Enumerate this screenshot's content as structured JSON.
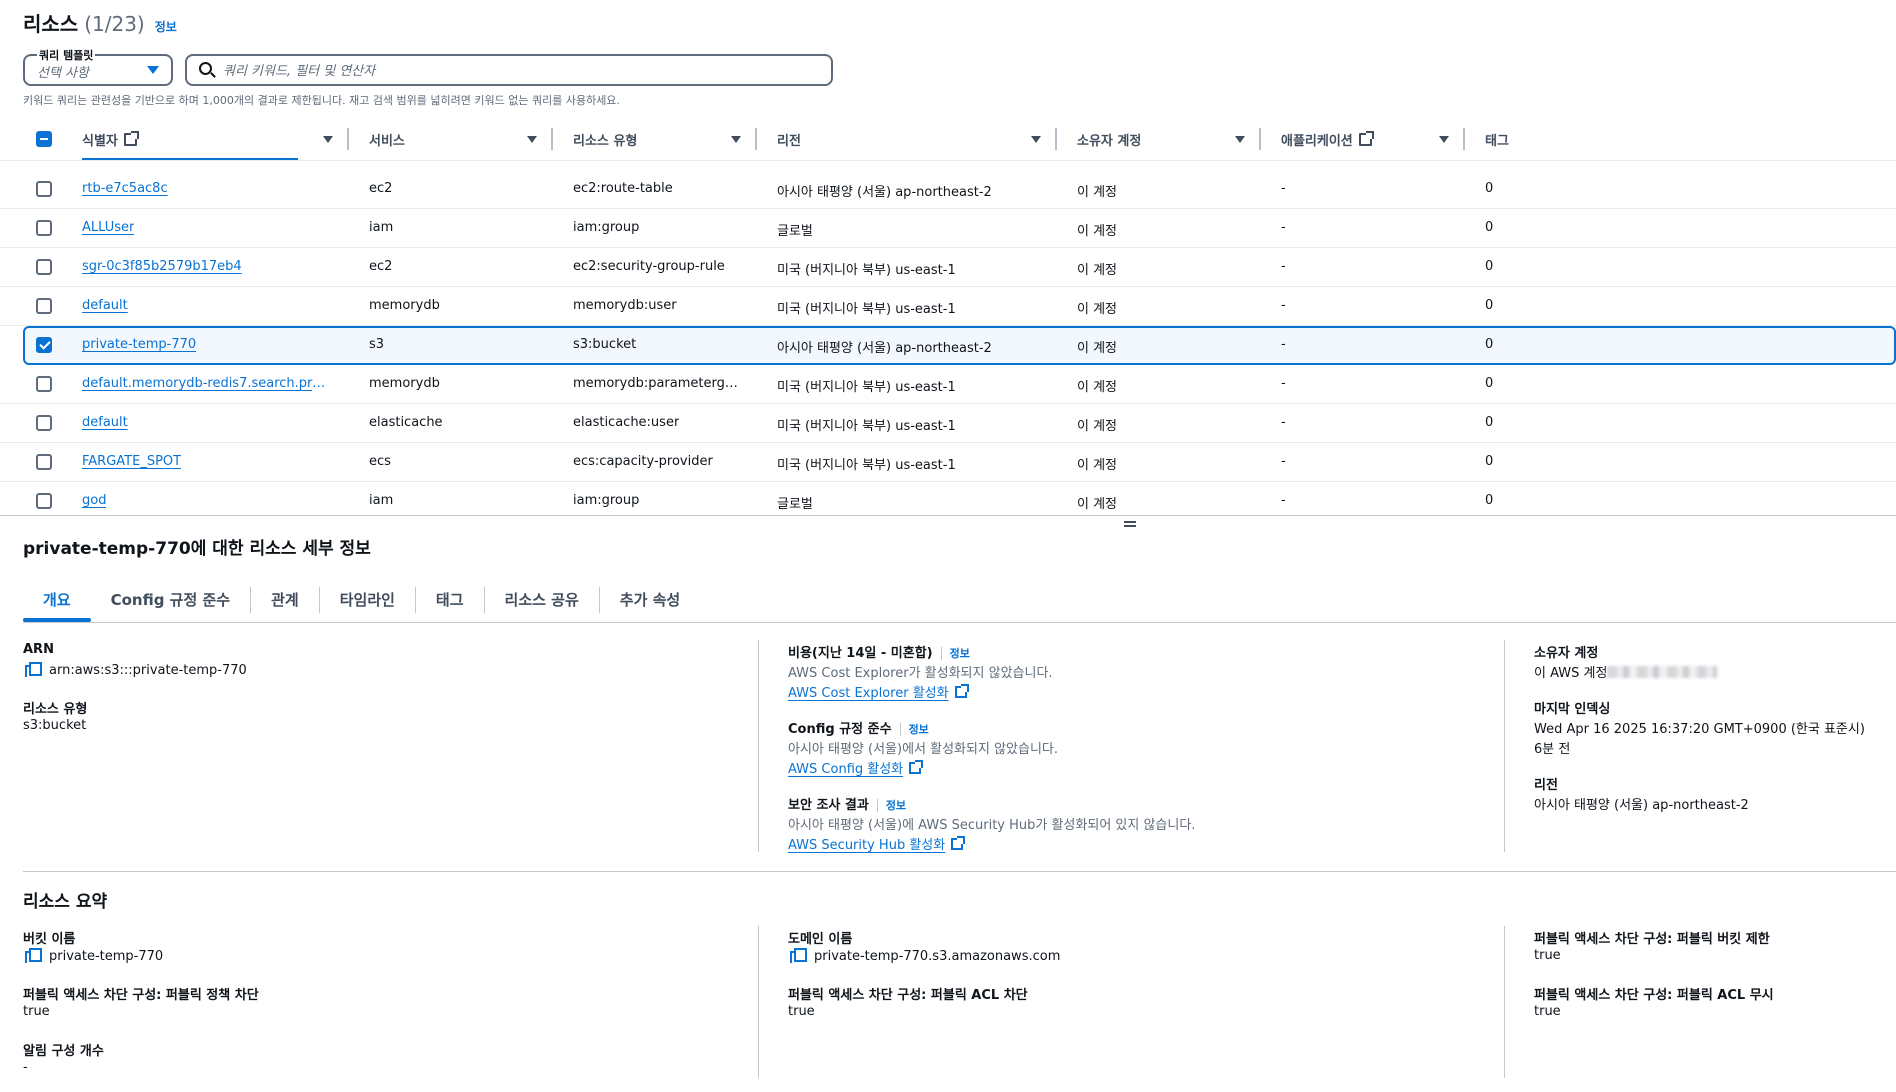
{
  "header": {
    "title": "리소스",
    "count": "(1/23)",
    "info": "정보"
  },
  "query_template": {
    "label": "쿼리 템플릿",
    "value": "선택 사항"
  },
  "search": {
    "placeholder": "쿼리 키워드, 필터 및 연산자"
  },
  "hint": "키워드 쿼리는 관련성을 기반으로 하며 1,000개의 결과로 제한됩니다. 재고 검색 범위를 넓히려면 키워드 없는 쿼리를 사용하세요.",
  "columns": {
    "identifier": "식별자",
    "service": "서비스",
    "resource_type": "리소스 유형",
    "region": "리전",
    "owner": "소유자 계정",
    "application": "애플리케이션",
    "tags": "태그"
  },
  "rows": [
    {
      "id": "rtb-e7c5ac8c",
      "service": "ec2",
      "type": "ec2:route-table",
      "region": "아시아 태평양 (서울) ap-northeast-2",
      "owner": "이 계정",
      "app": "-",
      "tags": "0",
      "selected": false
    },
    {
      "id": "ALLUser",
      "service": "iam",
      "type": "iam:group",
      "region": "글로벌",
      "owner": "이 계정",
      "app": "-",
      "tags": "0",
      "selected": false
    },
    {
      "id": "sgr-0c3f85b2579b17eb4",
      "service": "ec2",
      "type": "ec2:security-group-rule",
      "region": "미국 (버지니아 북부) us-east-1",
      "owner": "이 계정",
      "app": "-",
      "tags": "0",
      "selected": false
    },
    {
      "id": "default",
      "service": "memorydb",
      "type": "memorydb:user",
      "region": "미국 (버지니아 북부) us-east-1",
      "owner": "이 계정",
      "app": "-",
      "tags": "0",
      "selected": false
    },
    {
      "id": "private-temp-770",
      "service": "s3",
      "type": "s3:bucket",
      "region": "아시아 태평양 (서울) ap-northeast-2",
      "owner": "이 계정",
      "app": "-",
      "tags": "0",
      "selected": true
    },
    {
      "id": "default.memorydb-redis7.search.pre…",
      "service": "memorydb",
      "type": "memorydb:parameterg…",
      "region": "미국 (버지니아 북부) us-east-1",
      "owner": "이 계정",
      "app": "-",
      "tags": "0",
      "selected": false
    },
    {
      "id": "default",
      "service": "elasticache",
      "type": "elasticache:user",
      "region": "미국 (버지니아 북부) us-east-1",
      "owner": "이 계정",
      "app": "-",
      "tags": "0",
      "selected": false
    },
    {
      "id": "FARGATE_SPOT",
      "service": "ecs",
      "type": "ecs:capacity-provider",
      "region": "미국 (버지니아 북부) us-east-1",
      "owner": "이 계정",
      "app": "-",
      "tags": "0",
      "selected": false
    },
    {
      "id": "god",
      "service": "iam",
      "type": "iam:group",
      "region": "글로벌",
      "owner": "이 계정",
      "app": "-",
      "tags": "0",
      "selected": false
    }
  ],
  "detail": {
    "title": "private-temp-770에 대한 리소스 세부 정보",
    "tabs": [
      "개요",
      "Config 규정 준수",
      "관계",
      "타임라인",
      "태그",
      "리소스 공유",
      "추가 속성"
    ],
    "arn_label": "ARN",
    "arn_value": "arn:aws:s3:::private-temp-770",
    "type_label": "리소스 유형",
    "type_value": "s3:bucket",
    "cost_label": "비용(지난 14일 - 미혼합)",
    "cost_info": "정보",
    "cost_text": "AWS Cost Explorer가 활성화되지 않았습니다.",
    "cost_link": "AWS Cost Explorer 활성화",
    "config_label": "Config 규정 준수",
    "config_info": "정보",
    "config_text": "아시아 태평양 (서울)에서 활성화되지 않았습니다.",
    "config_link": "AWS Config 활성화",
    "security_label": "보안 조사 결과",
    "security_info": "정보",
    "security_text": "아시아 태평양 (서울)에 AWS Security Hub가 활성화되어 있지 않습니다.",
    "security_link": "AWS Security Hub 활성화",
    "owner_label": "소유자 계정",
    "owner_value": "이 AWS 계정",
    "indexed_label": "마지막 인덱싱",
    "indexed_value": "Wed Apr 16 2025 16:37:20 GMT+0900 (한국 표준시)",
    "indexed_ago": "6분 전",
    "region_label": "리전",
    "region_value": "아시아 태평양 (서울) ap-northeast-2"
  },
  "summary": {
    "title": "리소스 요약",
    "bucket_label": "버킷 이름",
    "bucket_value": "private-temp-770",
    "domain_label": "도메인 이름",
    "domain_value": "private-temp-770.s3.amazonaws.com",
    "pab_bucket_label": "퍼블릭 액세스 차단 구성: 퍼블릭 버킷 제한",
    "pab_bucket_value": "true",
    "pab_policy_label": "퍼블릭 액세스 차단 구성: 퍼블릭 정책 차단",
    "pab_policy_value": "true",
    "pab_acl_label": "퍼블릭 액세스 차단 구성: 퍼블릭 ACL 차단",
    "pab_acl_value": "true",
    "pab_ignore_label": "퍼블릭 액세스 차단 구성: 퍼블릭 ACL 무시",
    "pab_ignore_value": "true",
    "notif_label": "알림 구성 개수",
    "notif_value": "-"
  },
  "colors": {
    "accent": "#0972d3",
    "text": "#0f141a",
    "muted": "#5f6b7a",
    "selected_bg": "#f2f8fd"
  }
}
